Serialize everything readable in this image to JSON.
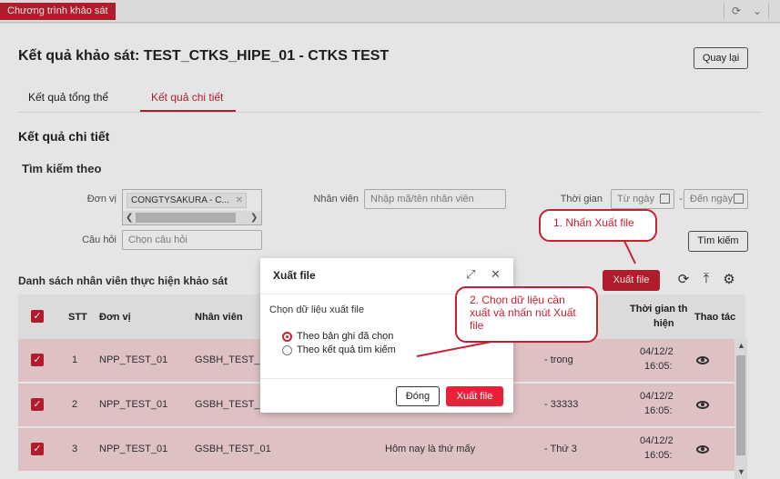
{
  "topbar": {
    "app_tab": "Chương trình khảo sát"
  },
  "page": {
    "title": "Kết quả khảo sát: TEST_CTKS_HIPE_01 - CTKS TEST",
    "back_button": "Quay lại",
    "tabs": [
      {
        "label": "Kết quả tổng thể",
        "active": false
      },
      {
        "label": "Kết quả chi tiết",
        "active": true
      }
    ],
    "section_title": "Kết quả chi tiết",
    "search": {
      "title": "Tìm kiếm theo",
      "unit_label": "Đơn vị",
      "unit_chip": "CONGTYSAKURA - C...",
      "employee_label": "Nhân viên",
      "employee_placeholder": "Nhập mã/tên nhân viên",
      "time_label": "Thời gian",
      "from_placeholder": "Từ ngày",
      "dash": "-",
      "to_placeholder": "Đến ngày",
      "question_label": "Câu hỏi",
      "question_placeholder": "Chọn câu hỏi",
      "search_button": "Tìm kiếm"
    },
    "list": {
      "title": "Danh sách nhân viên thực hiện khảo sát",
      "export_button": "Xuất file",
      "icons": [
        "refresh-icon",
        "upload-icon",
        "settings-icon"
      ],
      "columns": {
        "stt": "STT",
        "unit": "Đơn vị",
        "employee": "Nhân viên",
        "time_line1": "Thời gian th",
        "time_line2": "hiện",
        "actions": "Thao tác"
      },
      "rows": [
        {
          "stt": "1",
          "unit": "NPP_TEST_01",
          "employee": "GSBH_TEST_0",
          "question": "",
          "answer": "- trong",
          "date": "04/12/2",
          "time": "16:05:"
        },
        {
          "stt": "2",
          "unit": "NPP_TEST_01",
          "employee": "GSBH_TEST_0",
          "question": "",
          "answer": "- 33333",
          "date": "04/12/2",
          "time": "16:05:"
        },
        {
          "stt": "3",
          "unit": "NPP_TEST_01",
          "employee": "GSBH_TEST_01",
          "question": "Hôm nay là thứ mấy",
          "answer": "- Thứ 3",
          "date": "04/12/2",
          "time": "16:05:"
        }
      ]
    }
  },
  "modal": {
    "title": "Xuất file",
    "label": "Chọn dữ liệu xuất file",
    "options": [
      {
        "label": "Theo bản ghi đã chọn",
        "checked": true
      },
      {
        "label": "Theo kết quả tìm kiếm",
        "checked": false
      }
    ],
    "close_button": "Đóng",
    "export_button": "Xuất file"
  },
  "annotations": {
    "step1": "1. Nhấn Xuất file",
    "step2_line1": "2. Chọn dữ liệu cần",
    "step2_line2": "xuất và nhấn nút Xuất",
    "step2_line3": "file",
    "color": "#c62031"
  },
  "colors": {
    "brand": "#c62031",
    "row_selected": "#f8d7da"
  }
}
